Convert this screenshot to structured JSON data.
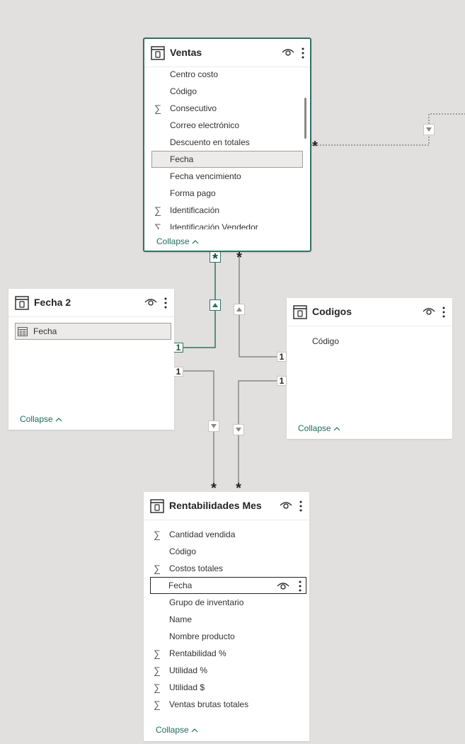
{
  "colors": {
    "canvas": "#e1e0df",
    "card": "#ffffff",
    "selected_border": "#2f7360",
    "line": "#8a8886",
    "selected_line": "#2f7360",
    "collapse_link": "#1c6d5a"
  },
  "tables": {
    "ventas": {
      "title": "Ventas",
      "icon": "table-icon",
      "fields": [
        {
          "label": "Centro costo",
          "sum": false
        },
        {
          "label": "Código",
          "sum": false
        },
        {
          "label": "Consecutivo",
          "sum": true
        },
        {
          "label": "Correo electrónico",
          "sum": false
        },
        {
          "label": "Descuento en totales",
          "sum": false
        },
        {
          "label": "Fecha",
          "sum": false,
          "highlighted": true
        },
        {
          "label": "Fecha vencimiento",
          "sum": false
        },
        {
          "label": "Forma pago",
          "sum": false
        },
        {
          "label": "Identificación",
          "sum": true
        },
        {
          "label": "Identificación Vendedor",
          "sum": true
        }
      ],
      "collapse_label": "Collapse"
    },
    "fecha2": {
      "title": "Fecha 2",
      "icon": "table-icon",
      "fields": [
        {
          "label": "Fecha",
          "sum": false,
          "highlighted": true,
          "icon": "calendar-icon"
        }
      ],
      "collapse_label": "Collapse"
    },
    "codigos": {
      "title": "Codigos",
      "icon": "table-icon",
      "fields": [
        {
          "label": "Código",
          "sum": false
        }
      ],
      "collapse_label": "Collapse"
    },
    "rentabilidades": {
      "title": "Rentabilidades Mes",
      "icon": "table-icon",
      "fields": [
        {
          "label": "Cantidad vendida",
          "sum": true
        },
        {
          "label": "Código",
          "sum": false
        },
        {
          "label": "Costos totales",
          "sum": true
        },
        {
          "label": "Fecha",
          "sum": false,
          "focused": true
        },
        {
          "label": "Grupo de inventario",
          "sum": false
        },
        {
          "label": "Name",
          "sum": false
        },
        {
          "label": "Nombre producto",
          "sum": false
        },
        {
          "label": "Rentabilidad %",
          "sum": true
        },
        {
          "label": "Utilidad %",
          "sum": true
        },
        {
          "label": "Utilidad $",
          "sum": true
        },
        {
          "label": "Ventas brutas totales",
          "sum": true
        }
      ],
      "collapse_label": "Collapse"
    }
  },
  "relationships": {
    "many_symbol": "*",
    "one_symbol": "1",
    "items": [
      {
        "from_table": "Ventas",
        "to_table": "Fecha 2",
        "from_card": "*",
        "to_card": "1",
        "active": true,
        "selected": true,
        "direction": "single"
      },
      {
        "from_table": "Ventas",
        "to_table": "Codigos",
        "from_card": "*",
        "to_card": "1",
        "active": true,
        "selected": false,
        "direction": "single"
      },
      {
        "from_table": "Ventas",
        "to_table": "",
        "from_card": "*",
        "to_card": "",
        "active": false,
        "selected": false,
        "direction": "single"
      },
      {
        "from_table": "Rentabilidades Mes",
        "to_table": "Fecha 2",
        "from_card": "*",
        "to_card": "1",
        "active": true,
        "selected": false,
        "direction": "single"
      },
      {
        "from_table": "Rentabilidades Mes",
        "to_table": "Codigos",
        "from_card": "*",
        "to_card": "1",
        "active": true,
        "selected": false,
        "direction": "single"
      }
    ]
  }
}
